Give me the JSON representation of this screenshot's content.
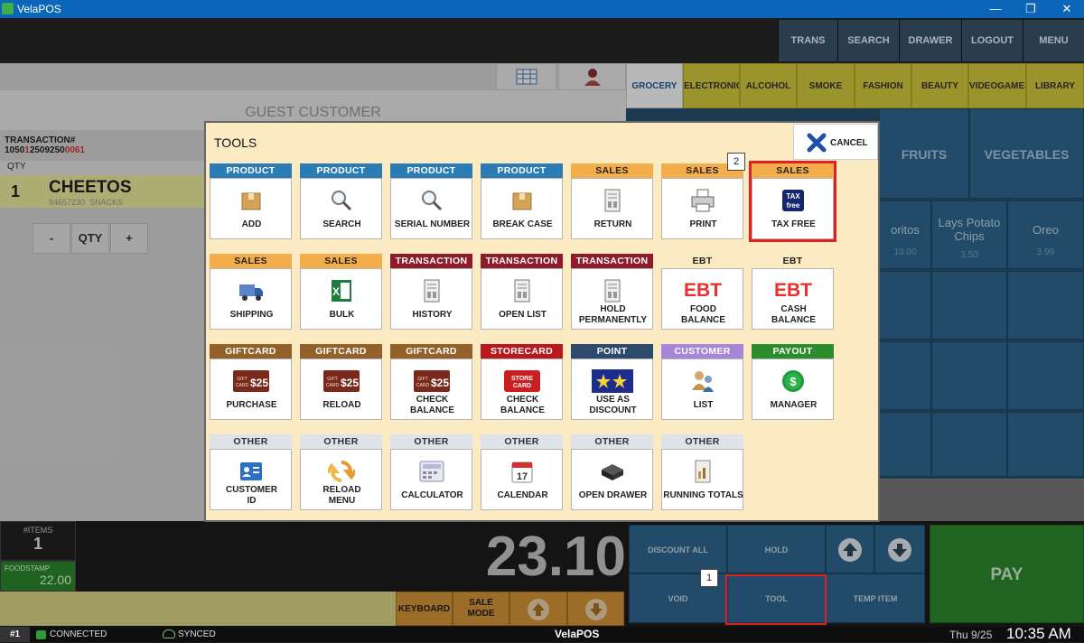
{
  "window": {
    "title": "VelaPOS",
    "minimize": "—",
    "restore": "❐",
    "close": "✕"
  },
  "topbar": {
    "buttons": [
      "TRANS",
      "SEARCH",
      "DRAWER",
      "LOGOUT",
      "MENU"
    ]
  },
  "customer": {
    "name": "GUEST CUSTOMER"
  },
  "transaction": {
    "label": "TRANSACTION#",
    "number_a": "1050",
    "number_b": "1",
    "number_c": "2509250",
    "number_d": "0",
    "number_e": "061"
  },
  "item_list": {
    "qty_header": "QTY",
    "items": [
      {
        "qty": "1",
        "name": "CHEETOS",
        "sku": "94657230",
        "category": "SNACKS"
      }
    ]
  },
  "qty_controls": {
    "minus": "-",
    "qty": "QTY",
    "plus": "+"
  },
  "categories": [
    "GROCERY",
    "ELECTRONIC",
    "ALCOHOL",
    "SMOKE",
    "FASHION",
    "BEAUTY",
    "VIDEOGAMES",
    "LIBRARY"
  ],
  "subcategories": [
    "FRUITS",
    "VEGETABLES"
  ],
  "products": [
    {
      "name": "oritos",
      "price": "10.00"
    },
    {
      "name": "Lays Potato Chips",
      "price": "3.50"
    },
    {
      "name": "Oreo",
      "price": "3.99"
    }
  ],
  "totals": {
    "items_label": "#ITEMS",
    "items_count": "1",
    "foodstamp_label": "FOODSTAMP",
    "foodstamp_value": "22.00",
    "total": "23.10"
  },
  "bottom_buttons": {
    "discount_all": "DISCOUNT ALL",
    "hold": "HOLD",
    "void": "VOID",
    "tool": "TOOL",
    "temp_item": "TEMP ITEM",
    "pay": "PAY",
    "keyboard": "KEYBOARD",
    "sale_mode": "SALE MODE"
  },
  "status": {
    "register": "#1",
    "connected": "CONNECTED",
    "synced": "SYNCED",
    "brand": "VelaPOS",
    "date": "Thu 9/25",
    "time": "10:35 AM"
  },
  "markers": {
    "m1": "1",
    "m2": "2"
  },
  "tools": {
    "title": "TOOLS",
    "cancel": "CANCEL",
    "rows": [
      [
        {
          "header": "PRODUCT",
          "label": "ADD",
          "icon": "box-icon"
        },
        {
          "header": "PRODUCT",
          "label": "SEARCH",
          "icon": "magnifier-icon"
        },
        {
          "header": "PRODUCT",
          "label": "SERIAL NUMBER",
          "icon": "magnifier-icon"
        },
        {
          "header": "PRODUCT",
          "label": "BREAK CASE",
          "icon": "box-icon"
        },
        {
          "header": "SALES",
          "label": "RETURN",
          "icon": "receipt-icon"
        },
        {
          "header": "SALES",
          "label": "PRINT",
          "icon": "printer-icon"
        },
        {
          "header": "SALES",
          "label": "TAX FREE",
          "icon": "tax-free-icon"
        }
      ],
      [
        {
          "header": "SALES",
          "label": "SHIPPING",
          "icon": "truck-icon"
        },
        {
          "header": "SALES",
          "label": "BULK",
          "icon": "excel-icon"
        },
        {
          "header": "TRANSACTION",
          "label": "HISTORY",
          "icon": "receipt-icon"
        },
        {
          "header": "TRANSACTION",
          "label": "OPEN LIST",
          "icon": "receipt-icon"
        },
        {
          "header": "TRANSACTION",
          "label1": "HOLD",
          "label2": "PERMANENTLY",
          "icon": "receipt-icon"
        },
        {
          "header": "EBT",
          "label1": "FOOD",
          "label2": "BALANCE",
          "icon": "ebt-icon",
          "icon_text": "EBT"
        },
        {
          "header": "EBT",
          "label1": "CASH",
          "label2": "BALANCE",
          "icon": "ebt-icon",
          "icon_text": "EBT"
        }
      ],
      [
        {
          "header": "GIFTCARD",
          "label": "PURCHASE",
          "icon": "giftcard-icon",
          "icon_text": "$25"
        },
        {
          "header": "GIFTCARD",
          "label": "RELOAD",
          "icon": "giftcard-icon",
          "icon_text": "$25"
        },
        {
          "header": "GIFTCARD",
          "label1": "CHECK",
          "label2": "BALANCE",
          "icon": "giftcard-icon",
          "icon_text": "$25"
        },
        {
          "header": "STORECARD",
          "label1": "CHECK",
          "label2": "BALANCE",
          "icon": "storecard-icon",
          "icon_text": "STORE CARD"
        },
        {
          "header": "POINT",
          "label1": "USE AS",
          "label2": "DISCOUNT",
          "icon": "stars-icon"
        },
        {
          "header": "CUSTOMER",
          "label": "LIST",
          "icon": "people-icon"
        },
        {
          "header": "PAYOUT",
          "label": "MANAGER",
          "icon": "dollar-coin-icon"
        }
      ],
      [
        {
          "header": "OTHER",
          "label1": "CUSTOMER",
          "label2": "ID",
          "icon": "id-card-icon"
        },
        {
          "header": "OTHER",
          "label1": "RELOAD",
          "label2": "MENU",
          "icon": "reload-icon"
        },
        {
          "header": "OTHER",
          "label": "CALCULATOR",
          "icon": "calculator-icon"
        },
        {
          "header": "OTHER",
          "label": "CALENDAR",
          "icon": "calendar-icon",
          "icon_text": "17"
        },
        {
          "header": "OTHER",
          "label": "OPEN DRAWER",
          "icon": "drawer-icon"
        },
        {
          "header": "OTHER",
          "label": "RUNNING TOTALS",
          "icon": "report-icon"
        }
      ]
    ]
  }
}
